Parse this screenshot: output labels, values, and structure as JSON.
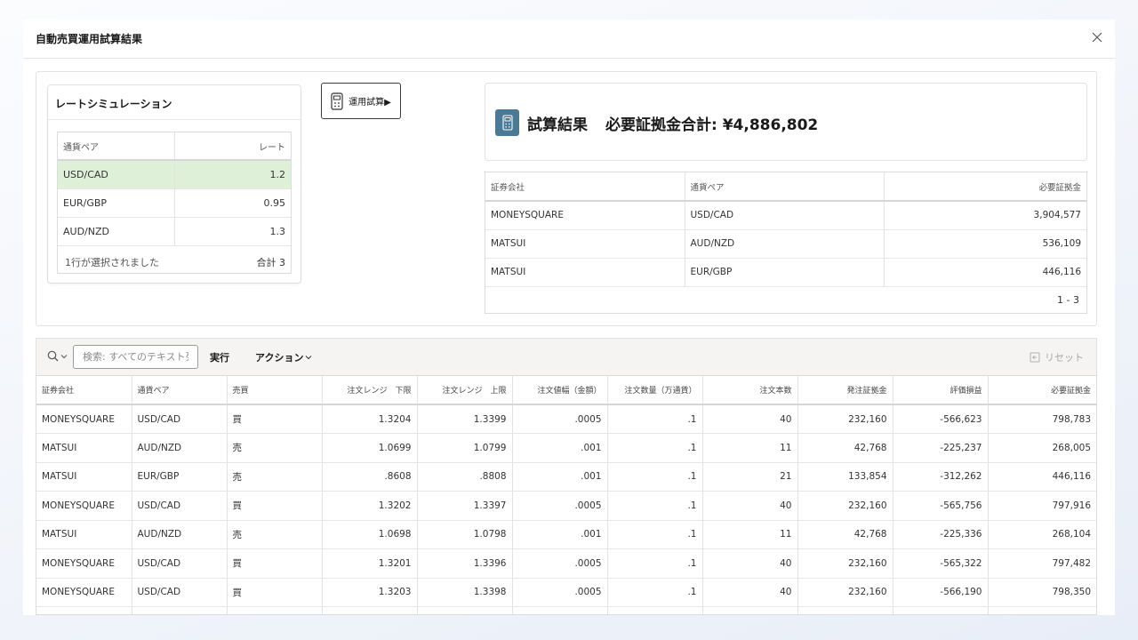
{
  "dialog": {
    "title": "自動売買運用試算結果",
    "close_label": "×"
  },
  "rate_simulation": {
    "title": "レートシミュレーション",
    "columns": [
      "通貨ペア",
      "レート"
    ],
    "rows": [
      {
        "pair": "USD/CAD",
        "rate": "1.2"
      },
      {
        "pair": "EUR/GBP",
        "rate": "0.95"
      },
      {
        "pair": "AUD/NZD",
        "rate": "1.3"
      }
    ],
    "footer_selected": "1行が選択されました",
    "footer_total": "合計 3"
  },
  "run_button": {
    "label": "運用試算▶"
  },
  "result": {
    "title": "試算結果",
    "total_label": "必要証拠金合計: ¥4,886,802",
    "columns": [
      "証券会社",
      "通貨ペア",
      "必要証拠金"
    ],
    "rows": [
      {
        "broker": "MONEYSQUARE",
        "pair": "USD/CAD",
        "margin": "3,904,577"
      },
      {
        "broker": "MATSUI",
        "pair": "AUD/NZD",
        "margin": "536,109"
      },
      {
        "broker": "MATSUI",
        "pair": "EUR/GBP",
        "margin": "446,116"
      }
    ],
    "pagination": "1 - 3"
  },
  "toolbar": {
    "search_placeholder": "検索: すべてのテキスト列",
    "go_label": "実行",
    "actions_label": "アクション",
    "reset_label": "リセット"
  },
  "main_grid": {
    "columns": [
      "証券会社",
      "通貨ペア",
      "売買",
      "注文レンジ　下限",
      "注文レンジ　上限",
      "注文値幅（金額）",
      "注文数量（万通貨）",
      "注文本数",
      "発注証拠金",
      "評価損益",
      "必要証拠金"
    ],
    "rows": [
      [
        "MONEYSQUARE",
        "USD/CAD",
        "買",
        "1.3204",
        "1.3399",
        ".0005",
        ".1",
        "40",
        "232,160",
        "-566,623",
        "798,783"
      ],
      [
        "MATSUI",
        "AUD/NZD",
        "売",
        "1.0699",
        "1.0799",
        ".001",
        ".1",
        "11",
        "42,768",
        "-225,237",
        "268,005"
      ],
      [
        "MATSUI",
        "EUR/GBP",
        "売",
        ".8608",
        ".8808",
        ".001",
        ".1",
        "21",
        "133,854",
        "-312,262",
        "446,116"
      ],
      [
        "MONEYSQUARE",
        "USD/CAD",
        "買",
        "1.3202",
        "1.3397",
        ".0005",
        ".1",
        "40",
        "232,160",
        "-565,756",
        "797,916"
      ],
      [
        "MATSUI",
        "AUD/NZD",
        "売",
        "1.0698",
        "1.0798",
        ".001",
        ".1",
        "11",
        "42,768",
        "-225,336",
        "268,104"
      ],
      [
        "MONEYSQUARE",
        "USD/CAD",
        "買",
        "1.3201",
        "1.3396",
        ".0005",
        ".1",
        "40",
        "232,160",
        "-565,322",
        "797,482"
      ],
      [
        "MONEYSQUARE",
        "USD/CAD",
        "買",
        "1.3203",
        "1.3398",
        ".0005",
        ".1",
        "40",
        "232,160",
        "-566,190",
        "798,350"
      ],
      [
        "",
        "",
        "",
        "",
        "",
        "",
        "",
        "",
        "",
        "",
        ""
      ]
    ]
  },
  "colors": {
    "selected_row": "#dff0d8",
    "result_icon": "#4b7a96",
    "toolbar_bg": "#f5f4f2"
  }
}
